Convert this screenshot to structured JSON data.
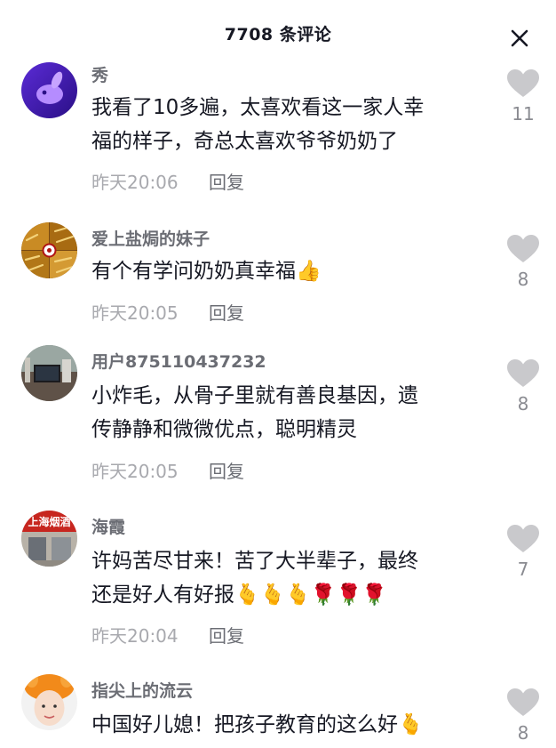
{
  "header": {
    "title": "7708 条评论"
  },
  "comments": [
    {
      "username": "秀",
      "lines": [
        "我看了10多遍，太喜欢看这一家人幸",
        "福的样子，奇总太喜欢爷爷奶奶了"
      ],
      "time": "昨天20:06",
      "reply_label": "回复",
      "likes": "11"
    },
    {
      "username": "爱上盐焗的妹子",
      "lines": [
        "有个有学问奶奶真幸福👍"
      ],
      "time": "昨天20:05",
      "reply_label": "回复",
      "likes": "8"
    },
    {
      "username": "用户875110437232",
      "lines": [
        "小炸毛，从骨子里就有善良基因，遗",
        "传静静和微微优点，聪明精灵"
      ],
      "time": "昨天20:05",
      "reply_label": "回复",
      "likes": "8"
    },
    {
      "username": "海霞",
      "lines": [
        "许妈苦尽甘来！苦了大半辈子，最终",
        "还是好人有好报🫰🫰🫰🌹🌹🌹"
      ],
      "time": "昨天20:04",
      "reply_label": "回复",
      "likes": "7",
      "avatar_text": "上海烟酒"
    },
    {
      "username": "指尖上的流云",
      "lines": [
        "中国好儿媳！把孩子教育的这么好🫰"
      ],
      "time": "",
      "reply_label": "",
      "likes": "8"
    }
  ],
  "icons": {
    "close": "close-icon",
    "like": "heart-icon"
  },
  "colors": {
    "username": "#6b6d74",
    "meta": "#a8a9ae",
    "heart": "#c9c9cc"
  }
}
